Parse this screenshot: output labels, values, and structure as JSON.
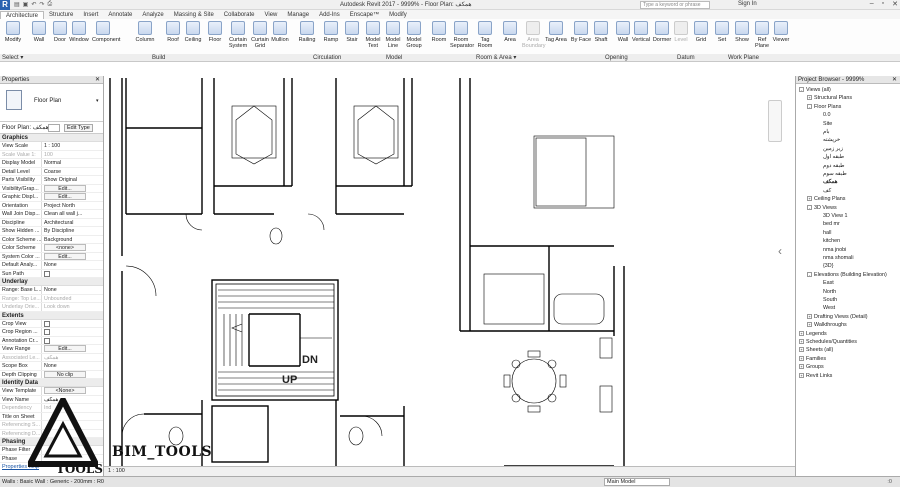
{
  "app": {
    "logo": "R",
    "title": "Autodesk Revit 2017 -    9999% - Floor Plan: همکف",
    "search_placeholder": "Type a keyword or phrase",
    "sign_in": "Sign In",
    "qat_icons": [
      "open-icon",
      "save-icon",
      "undo-icon",
      "redo-icon",
      "print-icon"
    ]
  },
  "tabs": [
    "Architecture",
    "Structure",
    "Insert",
    "Annotate",
    "Analyze",
    "Massing & Site",
    "Collaborate",
    "View",
    "Manage",
    "Add-Ins",
    "Enscape™",
    "Modify"
  ],
  "ribbon": {
    "buttons": [
      "Modify",
      "Wall",
      "Door",
      "Window",
      "Component",
      "Column",
      "Roof",
      "Ceiling",
      "Floor",
      "Curtain System",
      "Curtain Grid",
      "Mullion",
      "Railing",
      "Ramp",
      "Stair",
      "Model Text",
      "Model Line",
      "Model Group",
      "Room",
      "Room Separator",
      "Tag Room",
      "Area",
      "Area Boundary",
      "Tag Area",
      "By Face",
      "Shaft",
      "Wall",
      "Vertical",
      "Dormer",
      "Level",
      "Grid",
      "Set",
      "Show",
      "Ref Plane",
      "Viewer"
    ],
    "panels": [
      "Select ▾",
      "Build",
      "Circulation",
      "Model",
      "Room & Area ▾",
      "Opening",
      "Datum",
      "Work Plane"
    ]
  },
  "properties": {
    "header": "Properties",
    "type_name": "Floor Plan",
    "instance_label": "Floor Plan: همکف",
    "edit_type": "Edit Type",
    "groups": [
      {
        "name": "Graphics",
        "rows": [
          {
            "k": "View Scale",
            "v": "1 : 100"
          },
          {
            "k": "Scale Value    1:",
            "v": "100",
            "dim": true
          },
          {
            "k": "Display Model",
            "v": "Normal"
          },
          {
            "k": "Detail Level",
            "v": "Coarse"
          },
          {
            "k": "Parts Visibility",
            "v": "Show Original"
          },
          {
            "k": "Visibility/Grap...",
            "v": "Edit...",
            "btn": true
          },
          {
            "k": "Graphic Displ...",
            "v": "Edit...",
            "btn": true
          },
          {
            "k": "Orientation",
            "v": "Project North"
          },
          {
            "k": "Wall Join Disp...",
            "v": "Clean all wall j..."
          },
          {
            "k": "Discipline",
            "v": "Architectural"
          },
          {
            "k": "Show Hidden ...",
            "v": "By Discipline"
          },
          {
            "k": "Color Scheme ...",
            "v": "Background"
          },
          {
            "k": "Color Scheme",
            "v": "<none>",
            "btn": true
          },
          {
            "k": "System Color ...",
            "v": "Edit...",
            "btn": true
          },
          {
            "k": "Default Analy...",
            "v": "None"
          },
          {
            "k": "Sun Path",
            "v": "",
            "chk": true
          }
        ]
      },
      {
        "name": "Underlay",
        "rows": [
          {
            "k": "Range: Base L...",
            "v": "None"
          },
          {
            "k": "Range: Top Le...",
            "v": "Unbounded",
            "dim": true
          },
          {
            "k": "Underlay Orie...",
            "v": "Look down",
            "dim": true
          }
        ]
      },
      {
        "name": "Extents",
        "rows": [
          {
            "k": "Crop View",
            "v": "",
            "chk": true
          },
          {
            "k": "Crop Region ...",
            "v": "",
            "chk": true
          },
          {
            "k": "Annotation Cr...",
            "v": "",
            "chk": true
          },
          {
            "k": "View Range",
            "v": "Edit...",
            "btn": true
          },
          {
            "k": "Associated Le...",
            "v": "همکف",
            "dim": true
          },
          {
            "k": "Scope Box",
            "v": "None"
          },
          {
            "k": "Depth Clipping",
            "v": "No clip",
            "btn": true
          }
        ]
      },
      {
        "name": "Identity Data",
        "rows": [
          {
            "k": "View Template",
            "v": "<None>",
            "btn": true
          },
          {
            "k": "View Name",
            "v": "همکف"
          },
          {
            "k": "Dependency",
            "v": "Ind",
            "dim": true
          },
          {
            "k": "Title on Sheet",
            "v": ""
          },
          {
            "k": "Referencing S...",
            "v": "",
            "dim": true
          },
          {
            "k": "Referencing D...",
            "v": "",
            "dim": true
          }
        ]
      },
      {
        "name": "Phasing",
        "rows": [
          {
            "k": "Phase Filter",
            "v": ""
          },
          {
            "k": "Phase",
            "v": ""
          }
        ]
      }
    ],
    "help_link": "Properties help"
  },
  "canvas": {
    "stair_dn": "DN",
    "stair_up": "UP",
    "watermark": "BIM_TOOLS",
    "watermark_sub": "TOOLS"
  },
  "browser": {
    "header": "Project Browser - 9999%",
    "nodes": [
      {
        "t": "Views (all)",
        "lvl": 0,
        "tw": "-"
      },
      {
        "t": "Structural Plans",
        "lvl": 1,
        "tw": "+"
      },
      {
        "t": "Floor Plans",
        "lvl": 1,
        "tw": "-"
      },
      {
        "t": "0.0",
        "lvl": 2
      },
      {
        "t": "Site",
        "lvl": 2
      },
      {
        "t": "بام",
        "lvl": 2
      },
      {
        "t": "خرپشته",
        "lvl": 2
      },
      {
        "t": "زیر زمین",
        "lvl": 2
      },
      {
        "t": "طبقه اول",
        "lvl": 2
      },
      {
        "t": "طبقه دوم",
        "lvl": 2
      },
      {
        "t": "طبقه سوم",
        "lvl": 2
      },
      {
        "t": "همکف",
        "lvl": 2,
        "bold": true
      },
      {
        "t": "کف",
        "lvl": 2
      },
      {
        "t": "Ceiling Plans",
        "lvl": 1,
        "tw": "+"
      },
      {
        "t": "3D Views",
        "lvl": 1,
        "tw": "-"
      },
      {
        "t": "3D View 1",
        "lvl": 2
      },
      {
        "t": "bed mr",
        "lvl": 2
      },
      {
        "t": "hall",
        "lvl": 2
      },
      {
        "t": "kitchen",
        "lvl": 2
      },
      {
        "t": "nma jnobi",
        "lvl": 2
      },
      {
        "t": "nma shomali",
        "lvl": 2
      },
      {
        "t": "{3D}",
        "lvl": 2
      },
      {
        "t": "Elevations (Building Elevation)",
        "lvl": 1,
        "tw": "-"
      },
      {
        "t": "East",
        "lvl": 2
      },
      {
        "t": "North",
        "lvl": 2
      },
      {
        "t": "South",
        "lvl": 2
      },
      {
        "t": "West",
        "lvl": 2
      },
      {
        "t": "Drafting Views (Detail)",
        "lvl": 1,
        "tw": "+"
      },
      {
        "t": "Walkthroughs",
        "lvl": 1,
        "tw": "+"
      },
      {
        "t": "Legends",
        "lvl": 0,
        "tw": "+"
      },
      {
        "t": "Schedules/Quantities",
        "lvl": 0,
        "tw": "+"
      },
      {
        "t": "Sheets (all)",
        "lvl": 0,
        "tw": "+"
      },
      {
        "t": "Families",
        "lvl": 0,
        "tw": "+"
      },
      {
        "t": "Groups",
        "lvl": 0,
        "tw": "+"
      },
      {
        "t": "Revit Links",
        "lvl": 0,
        "tw": "+"
      }
    ]
  },
  "viewbar": {
    "scale": "1 : 100"
  },
  "status": {
    "text": "Walls : Basic Wall : Generic - 200mm : R0",
    "model": "Main Model",
    "right": ":0"
  }
}
